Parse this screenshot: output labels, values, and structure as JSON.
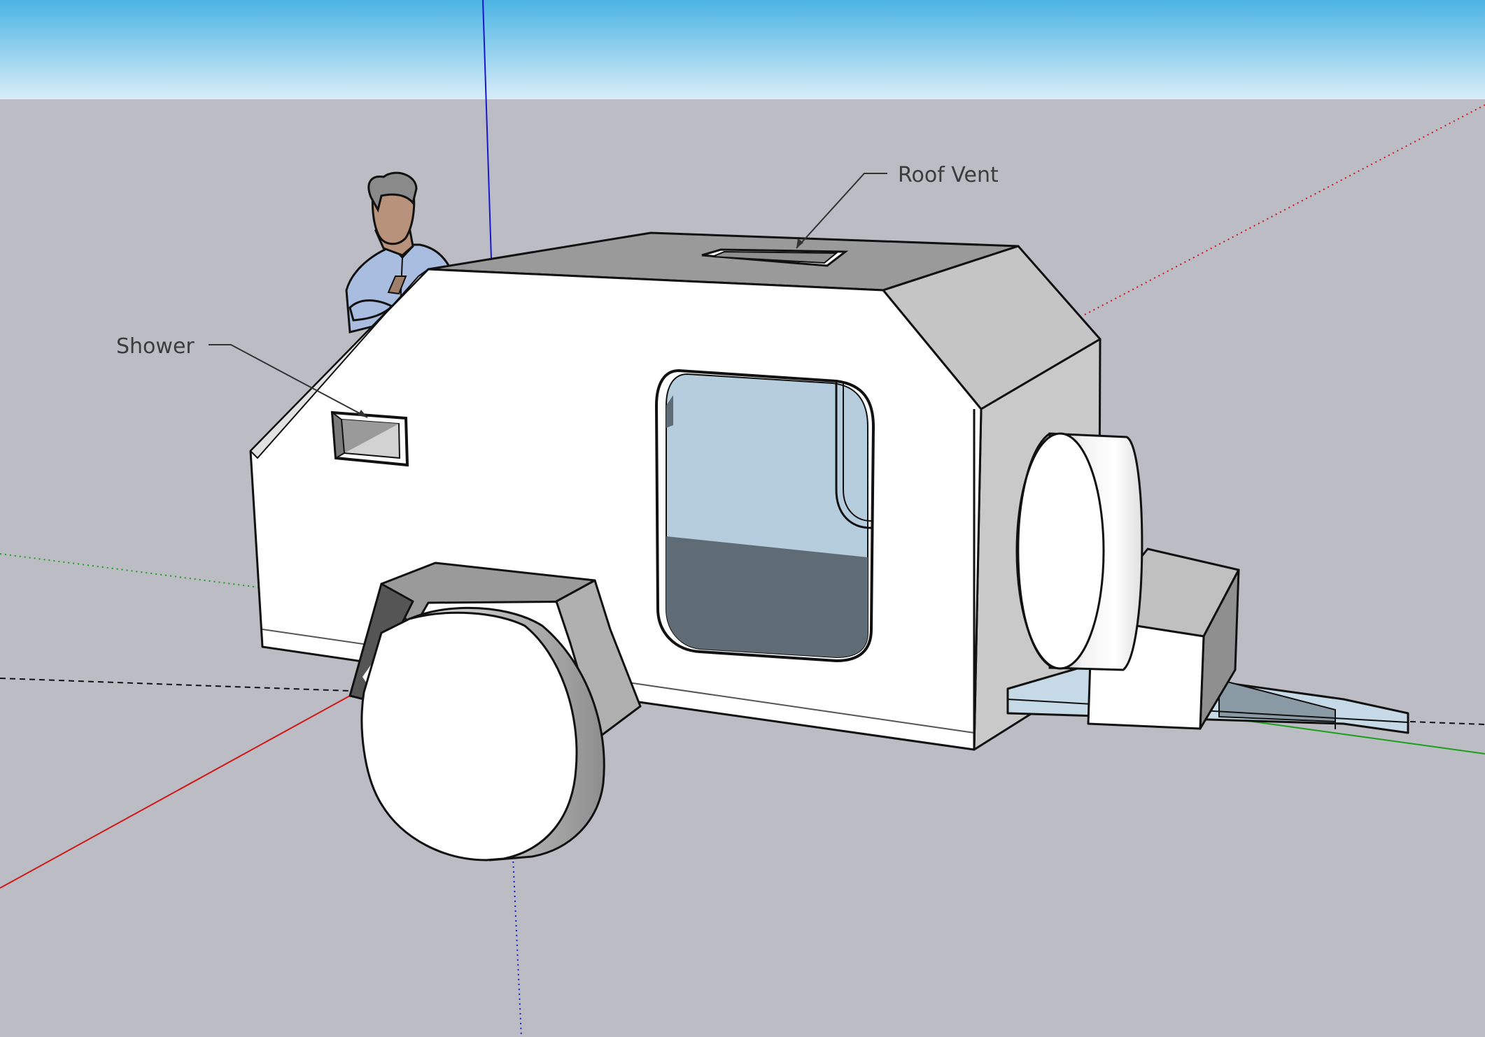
{
  "annotations": {
    "roof_vent": "Roof Vent",
    "shower": "Shower"
  },
  "colors": {
    "sky_top": "#4bb4e4",
    "sky_bottom": "#d8edf7",
    "ground": "#bcbcc4",
    "outline": "#111111",
    "panel_light": "#ffffff",
    "panel_mid": "#c9c9c9",
    "panel_dark": "#8f8f8f",
    "window_glass": "#b6cddd",
    "window_floor": "#5f6b75",
    "frame_blue": "#c6d9e6",
    "axis_red": "#d01818",
    "axis_green": "#1aa01a",
    "axis_blue": "#1818d0",
    "shirt": "#a8bde0"
  }
}
